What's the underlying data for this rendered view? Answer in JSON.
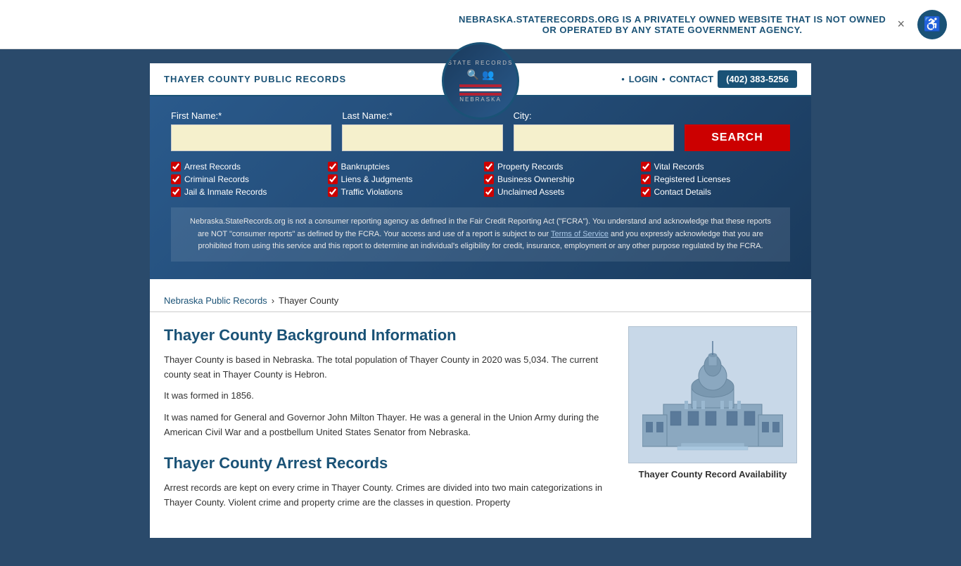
{
  "topBanner": {
    "text": "NEBRASKA.STATERECORDS.ORG IS A PRIVATELY OWNED WEBSITE THAT IS NOT OWNED OR OPERATED BY ANY STATE GOVERNMENT AGENCY.",
    "closeLabel": "×"
  },
  "accessibility": {
    "label": "♿"
  },
  "header": {
    "siteTitle": "THAYER COUNTY PUBLIC RECORDS",
    "logoTopText": "STATE RECORDS",
    "logoBottomText": "NEBRASKA",
    "navLogin": "LOGIN",
    "navContact": "CONTACT",
    "phone": "(402) 383-5256"
  },
  "search": {
    "firstNameLabel": "First Name:*",
    "lastNameLabel": "Last Name:*",
    "cityLabel": "City:",
    "firstNamePlaceholder": "",
    "lastNamePlaceholder": "",
    "cityPlaceholder": "",
    "searchButton": "SEARCH"
  },
  "checkboxes": [
    {
      "col": 1,
      "label": "Arrest Records",
      "checked": true
    },
    {
      "col": 1,
      "label": "Criminal Records",
      "checked": true
    },
    {
      "col": 1,
      "label": "Jail & Inmate Records",
      "checked": true
    },
    {
      "col": 2,
      "label": "Bankruptcies",
      "checked": true
    },
    {
      "col": 2,
      "label": "Liens & Judgments",
      "checked": true
    },
    {
      "col": 2,
      "label": "Traffic Violations",
      "checked": true
    },
    {
      "col": 3,
      "label": "Property Records",
      "checked": true
    },
    {
      "col": 3,
      "label": "Business Ownership",
      "checked": true
    },
    {
      "col": 3,
      "label": "Unclaimed Assets",
      "checked": true
    },
    {
      "col": 4,
      "label": "Vital Records",
      "checked": true
    },
    {
      "col": 4,
      "label": "Registered Licenses",
      "checked": true
    },
    {
      "col": 4,
      "label": "Contact Details",
      "checked": true
    }
  ],
  "disclaimer": {
    "text1": "Nebraska.StateRecords.org is not a consumer reporting agency as defined in the Fair Credit Reporting Act (\"FCRA\"). You understand and acknowledge that these reports are NOT \"consumer reports\" as defined by the FCRA. Your access and use of a report is subject to our ",
    "linkText": "Terms of Service",
    "text2": " and you expressly acknowledge that you are prohibited from using this service and this report to determine an individual's eligibility for credit, insurance, employment or any other purpose regulated by the FCRA."
  },
  "breadcrumb": {
    "link": "Nebraska Public Records",
    "separator": "›",
    "current": "Thayer County"
  },
  "content": {
    "backgroundTitle": "Thayer County Background Information",
    "backgroundPara1": "Thayer County is based in Nebraska. The total population of Thayer County in 2020 was 5,034. The current county seat in Thayer County is Hebron.",
    "backgroundPara2": "It was formed in 1856.",
    "backgroundPara3": "It was named for General and Governor John Milton Thayer. He was a general in the Union Army during the American Civil War and a postbellum United States Senator from Nebraska.",
    "arrestTitle": "Thayer County Arrest Records",
    "arrestPara1": "Arrest records are kept on every crime in Thayer County. Crimes are divided into two main categorizations in Thayer County. Violent crime and property crime are the classes in question. Property"
  },
  "sidebar": {
    "caption": "Thayer County Record Availability"
  }
}
